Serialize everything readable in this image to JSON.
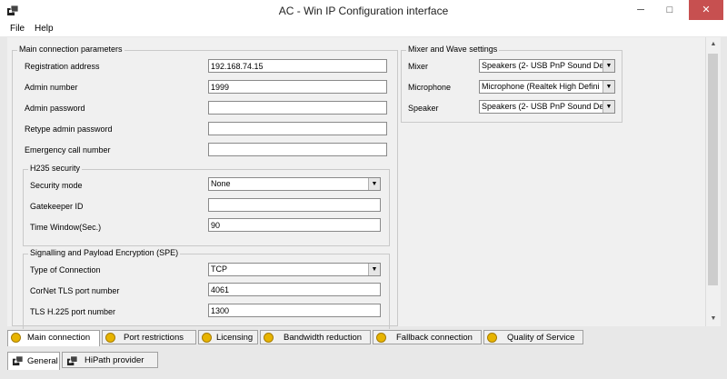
{
  "window": {
    "title": "AC - Win IP Configuration interface",
    "minimize": "─",
    "maximize": "□",
    "close": "✕"
  },
  "menu": [
    "File",
    "Help"
  ],
  "main_connection": {
    "title": "Main connection parameters",
    "registration_address": {
      "label": "Registration address",
      "value": "192.168.74.15"
    },
    "admin_number": {
      "label": "Admin number",
      "value": "1999"
    },
    "admin_password": {
      "label": "Admin password",
      "value": ""
    },
    "retype_password": {
      "label": "Retype admin password",
      "value": ""
    },
    "emergency_number": {
      "label": "Emergency call number",
      "value": ""
    }
  },
  "h235": {
    "title": "H235 security",
    "security_mode": {
      "label": "Security mode",
      "value": "None"
    },
    "gatekeeper_id": {
      "label": "Gatekeeper ID",
      "value": ""
    },
    "time_window": {
      "label": "Time Window(Sec.)",
      "value": "90"
    }
  },
  "spe": {
    "title": "Signalling and Payload Encryption (SPE)",
    "connection_type": {
      "label": "Type of Connection",
      "value": "TCP"
    },
    "cornet_port": {
      "label": "CorNet TLS port number",
      "value": "4061"
    },
    "h225_port": {
      "label": "TLS H.225 port number",
      "value": "1300"
    }
  },
  "mixer": {
    "title": "Mixer and Wave settings",
    "mixer": {
      "label": "Mixer",
      "value": "Speakers (2- USB PnP Sound Devi"
    },
    "microphone": {
      "label": "Microphone",
      "value": "Microphone (Realtek High Defini"
    },
    "speaker": {
      "label": "Speaker",
      "value": "Speakers (2- USB PnP Sound Devi"
    }
  },
  "tabs": [
    "Main connection",
    "Port restrictions",
    "Licensing",
    "Bandwidth reduction",
    "Fallback connection",
    "Quality of Service"
  ],
  "bottom_tabs": [
    "General",
    "HiPath provider"
  ],
  "icons": {
    "app": "app-icon",
    "tab": "settings-coin-icon",
    "dropdown": "dropdown-arrow-icon"
  },
  "colors": {
    "close_button": "#c75050",
    "tab_icon": "#e7b400"
  }
}
